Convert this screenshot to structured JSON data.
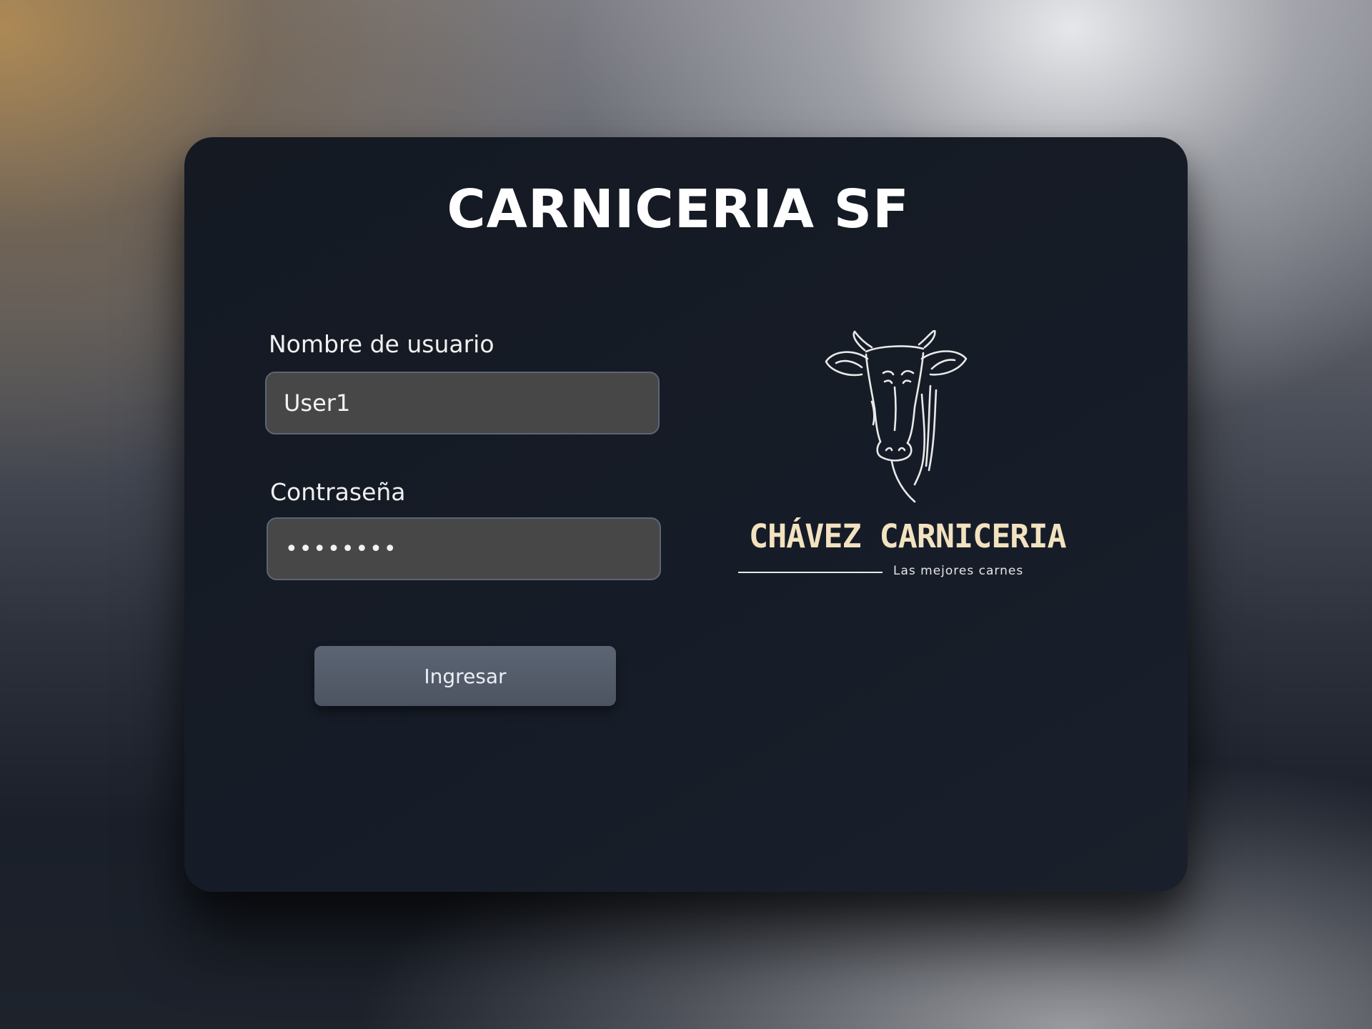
{
  "app": {
    "title": "CARNICERIA SF"
  },
  "login_form": {
    "username_label": "Nombre de usuario",
    "username_value": "User1",
    "password_label": "Contraseña",
    "password_value": "12345678",
    "submit_label": "Ingresar"
  },
  "logo": {
    "brand_name": "CHÁVEZ CARNICERIA",
    "tagline": "Las mejores carnes",
    "icon": "cow-head-icon",
    "brand_color": "#f3e2c0"
  },
  "colors": {
    "card_background": "#161c27",
    "input_background": "#474747",
    "button_background": "#545c6a"
  }
}
